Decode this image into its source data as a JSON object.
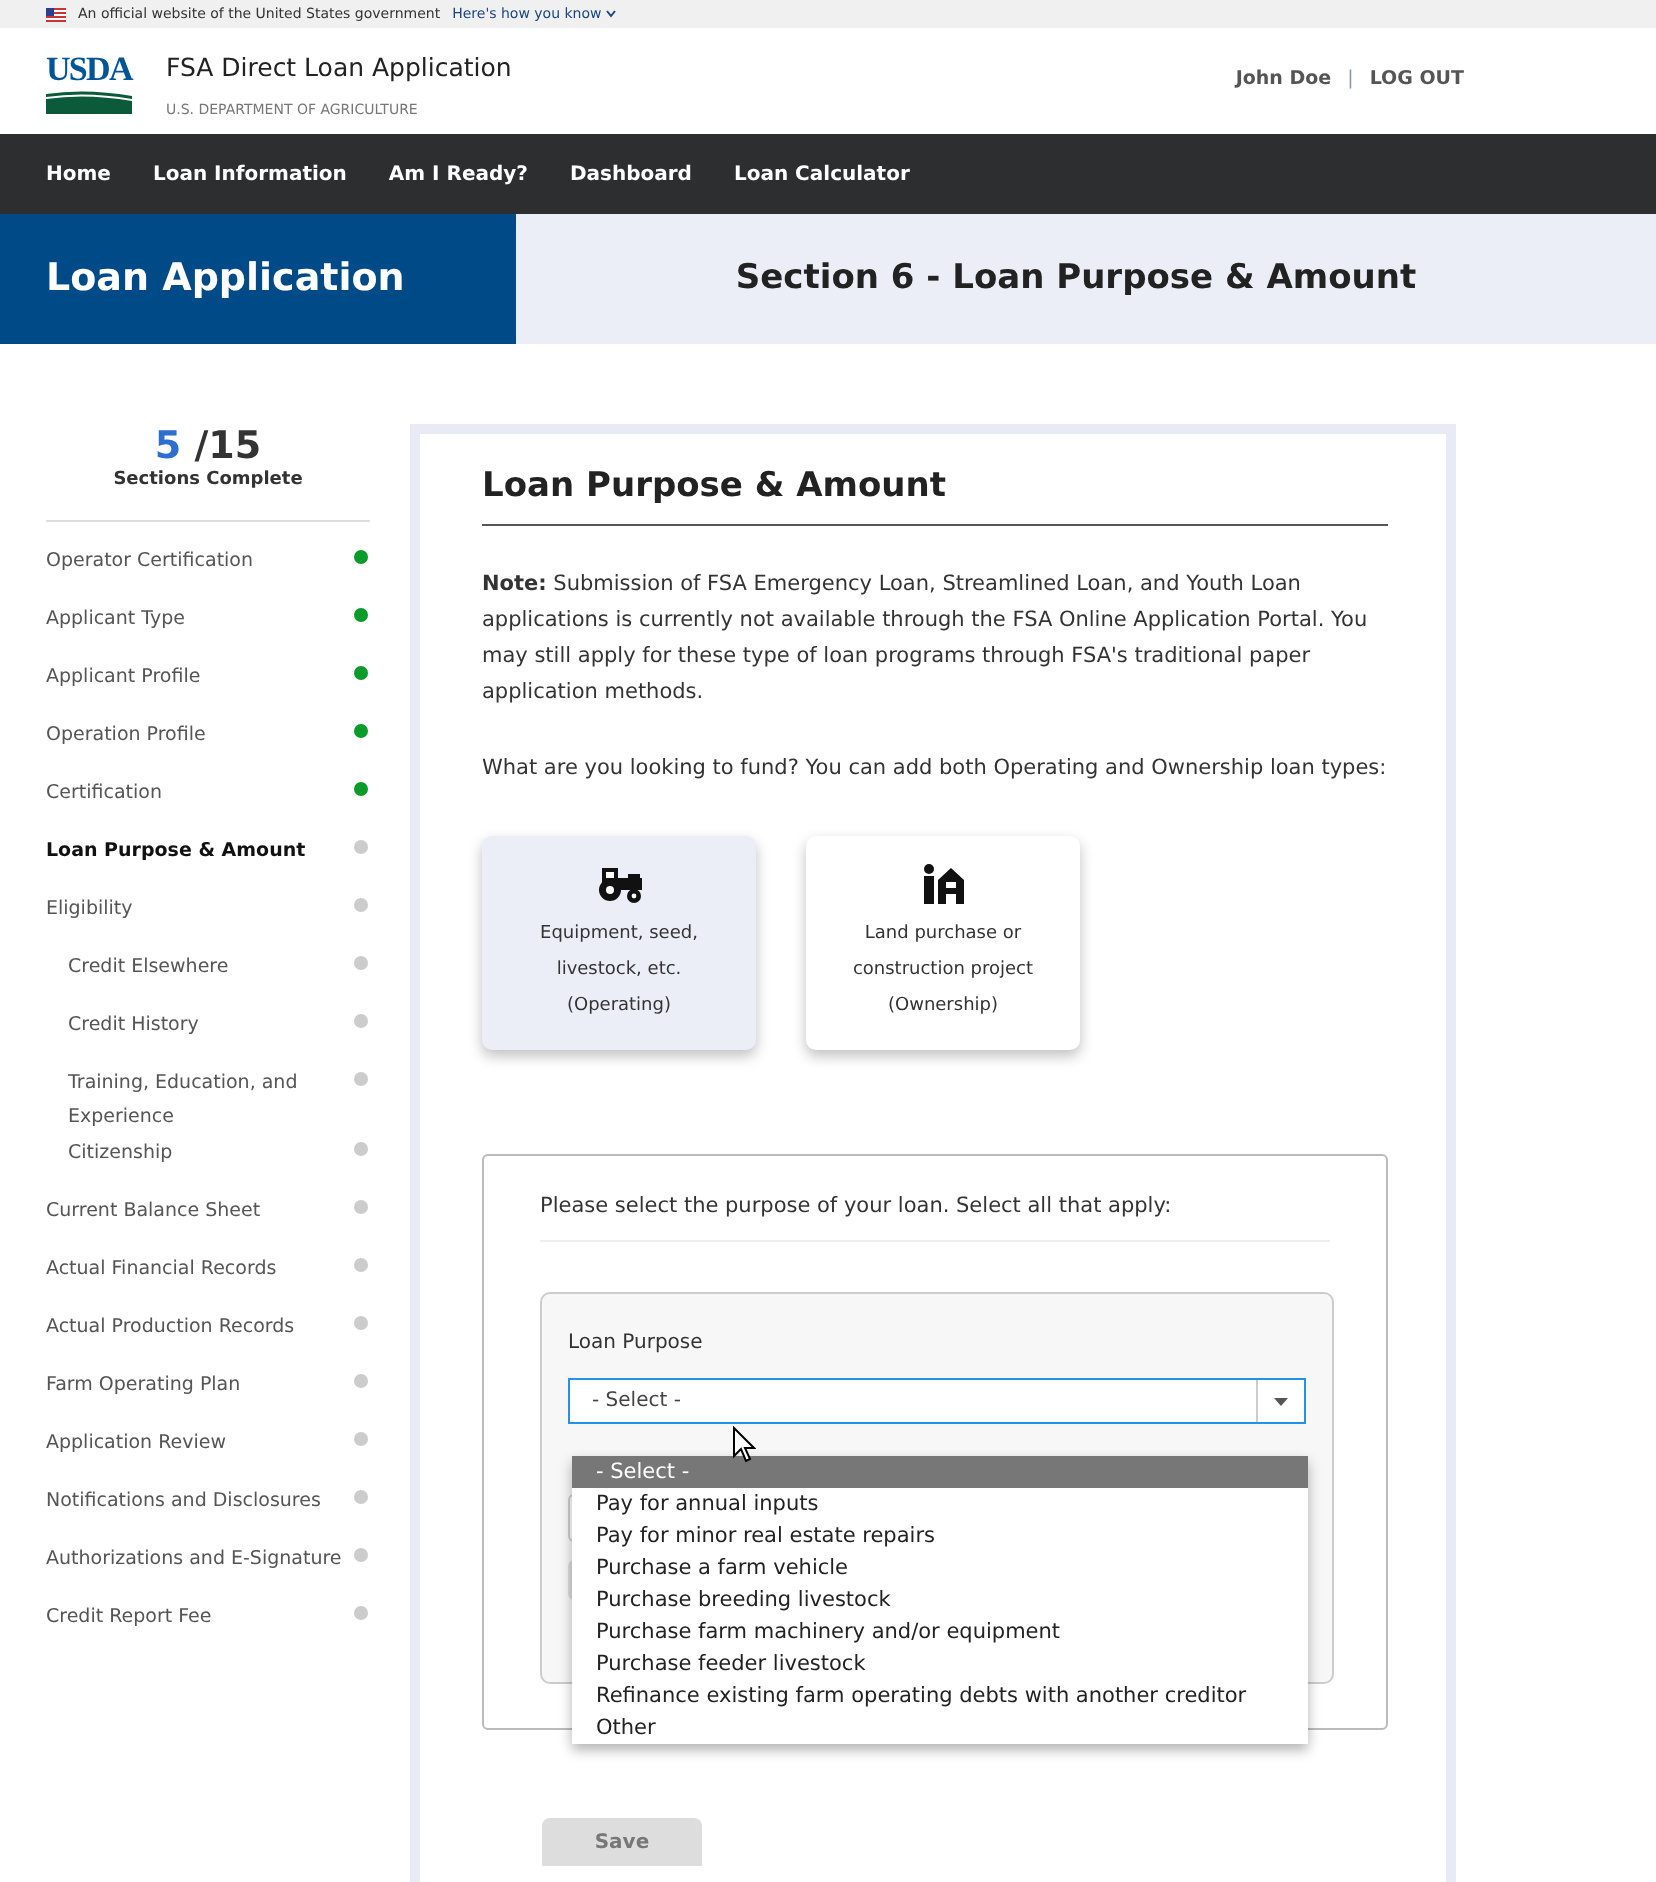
{
  "gov_banner": {
    "text": "An official website of the United States government",
    "link": "Here's how you know"
  },
  "header": {
    "logo": "USDA",
    "title": "FSA Direct Loan Application",
    "subtitle": "U.S. DEPARTMENT OF AGRICULTURE",
    "user": "John Doe",
    "separator": "|",
    "logout": "LOG OUT"
  },
  "nav": [
    "Home",
    "Loan Information",
    "Am I Ready?",
    "Dashboard",
    "Loan Calculator"
  ],
  "hero": {
    "title": "Loan Application",
    "section": "Section 6 - Loan Purpose & Amount"
  },
  "progress": {
    "done": "5",
    "total": "/15",
    "label": "Sections Complete"
  },
  "sidebar": {
    "items": [
      {
        "label": "Operator Certification",
        "complete": true,
        "selected": false
      },
      {
        "label": "Applicant Type",
        "complete": true,
        "selected": false
      },
      {
        "label": "Applicant Profile",
        "complete": true,
        "selected": false
      },
      {
        "label": "Operation Profile",
        "complete": true,
        "selected": false
      },
      {
        "label": "Certification",
        "complete": true,
        "selected": false
      },
      {
        "label": "Loan Purpose & Amount",
        "complete": false,
        "selected": true
      },
      {
        "label": "Eligibility",
        "complete": false,
        "selected": false,
        "children": [
          {
            "label": "Credit Elsewhere",
            "complete": false,
            "selected": false
          },
          {
            "label": "Credit History",
            "complete": false,
            "selected": false
          },
          {
            "label": "Training, Education, and Experience",
            "complete": false,
            "selected": false
          },
          {
            "label": "Citizenship",
            "complete": false,
            "selected": false
          }
        ]
      },
      {
        "label": "Current Balance Sheet",
        "complete": false,
        "selected": false
      },
      {
        "label": "Actual Financial Records",
        "complete": false,
        "selected": false
      },
      {
        "label": "Actual Production Records",
        "complete": false,
        "selected": false
      },
      {
        "label": "Farm Operating Plan",
        "complete": false,
        "selected": false
      },
      {
        "label": "Application Review",
        "complete": false,
        "selected": false
      },
      {
        "label": "Notifications and Disclosures",
        "complete": false,
        "selected": false
      },
      {
        "label": "Authorizations and E-Signature",
        "complete": false,
        "selected": false
      },
      {
        "label": "Credit Report Fee",
        "complete": false,
        "selected": false
      }
    ]
  },
  "main": {
    "title": "Loan Purpose & Amount",
    "note": "**Note:** Submission of FSA Emergency Loan, Streamlined Loan, and Youth Loan applications is currently not available through the FSA Online Application Portal. You may still apply for these type of loan programs through FSA's traditional paper application methods.",
    "question": "What are you looking to fund? You can add both Operating and Ownership loan types:",
    "loan_types": [
      {
        "kind": "tractor",
        "lines": [
          "Equipment, seed,",
          "livestock, etc.",
          "(Operating)"
        ],
        "selected": true
      },
      {
        "kind": "ownership",
        "lines": [
          "Land purchase or",
          "construction project",
          "(Ownership)"
        ],
        "selected": false
      }
    ],
    "purpose_panel": {
      "instruction": "Please select the purpose of your loan. Select all that apply:",
      "field_label": "Loan Purpose",
      "select_value": "- Select -",
      "options": [
        {
          "label": "- Select -",
          "selected": true
        },
        {
          "label": "Pay for annual inputs",
          "selected": false
        },
        {
          "label": "Pay for minor real estate repairs",
          "selected": false
        },
        {
          "label": "Purchase a farm vehicle",
          "selected": false
        },
        {
          "label": "Purchase breeding livestock",
          "selected": false
        },
        {
          "label": "Purchase farm machinery and/or equipment",
          "selected": false
        },
        {
          "label": "Purchase feeder livestock",
          "selected": false
        },
        {
          "label": "Refinance existing farm operating debts with another creditor",
          "selected": false
        },
        {
          "label": "Other",
          "selected": false
        }
      ]
    },
    "save_button": {
      "label": "Save",
      "disabled": true
    }
  }
}
